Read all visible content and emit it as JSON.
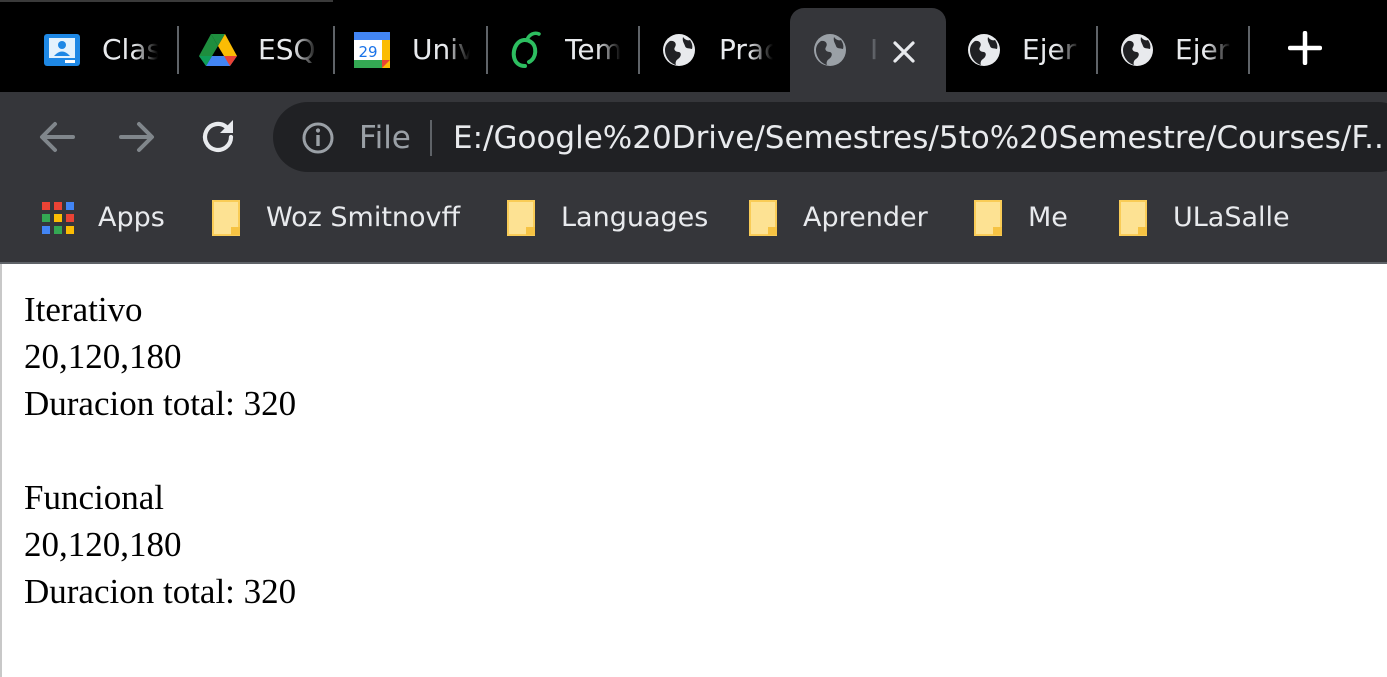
{
  "tabs": [
    {
      "label": "Clas",
      "icon": "google-classroom-icon"
    },
    {
      "label": "ESQ",
      "icon": "google-drive-icon"
    },
    {
      "label": "Univ",
      "icon": "google-calendar-icon",
      "icon_text": "29"
    },
    {
      "label": "Tem",
      "icon": "evernote-icon"
    },
    {
      "label": "Prac",
      "icon": "globe-icon"
    },
    {
      "label": "I",
      "icon": "globe-icon",
      "active": true
    },
    {
      "label": "Ejer",
      "icon": "globe-icon"
    },
    {
      "label": "Ejer",
      "icon": "globe-icon"
    }
  ],
  "toolbar": {
    "scheme": "File",
    "url": "E:/Google%20Drive/Semestres/5to%20Semestre/Courses/F..."
  },
  "bookmarks": [
    {
      "label": "Apps",
      "icon": "apps-grid-icon"
    },
    {
      "label": "Woz Smitnovff",
      "icon": "folder-icon"
    },
    {
      "label": "Languages",
      "icon": "folder-icon"
    },
    {
      "label": "Aprender",
      "icon": "folder-icon"
    },
    {
      "label": "Me",
      "icon": "folder-icon"
    },
    {
      "label": "ULaSalle",
      "icon": "folder-icon"
    }
  ],
  "page": {
    "iterativo": {
      "heading": "Iterativo",
      "values": "20,120,180",
      "total": "Duracion total: 320"
    },
    "funcional": {
      "heading": "Funcional",
      "values": "20,120,180",
      "total": "Duracion total: 320"
    }
  },
  "colors": {
    "tabstrip": "#000000",
    "toolbar": "#35363a",
    "omnibox": "#202124",
    "text_light": "#e8eaed",
    "folder": "#fde293"
  }
}
